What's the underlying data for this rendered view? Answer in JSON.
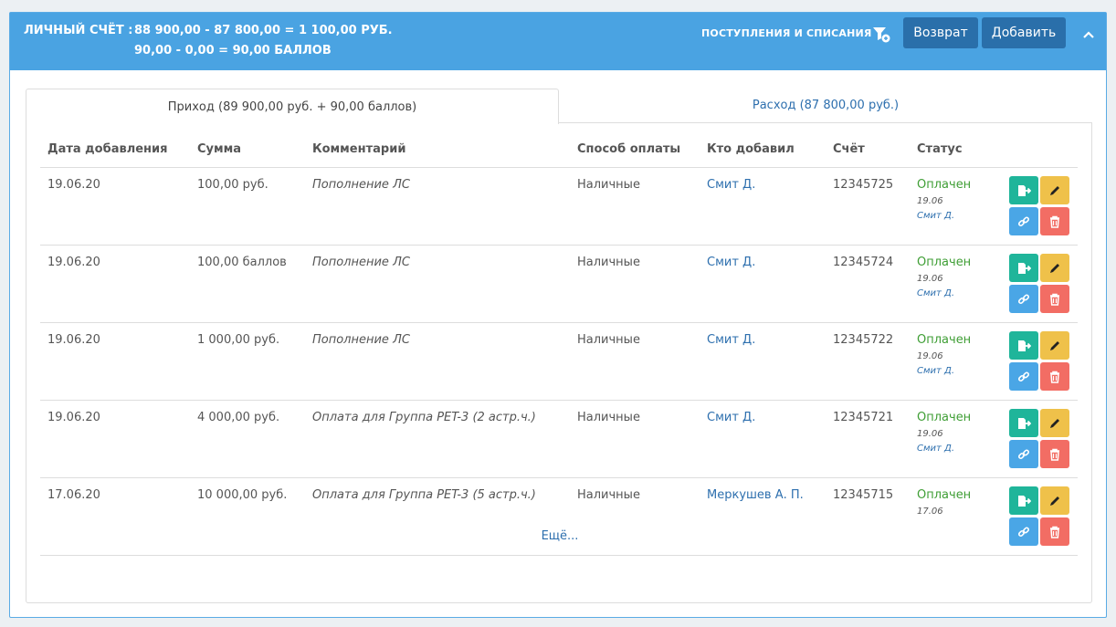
{
  "header": {
    "account_label": "ЛИЧНЫЙ СЧЁТ :",
    "line1": "88 900,00 - 87 800,00 = 1 100,00 РУБ.",
    "line2": "90,00 - 0,00 = 90,00 БАЛЛОВ",
    "link": "ПОСТУПЛЕНИЯ И СПИСАНИЯ",
    "return_label": "Возврат",
    "add_label": "Добавить"
  },
  "tabs": {
    "income": "Приход (89 900,00 руб. + 90,00 баллов)",
    "expense": "Расход (87 800,00 руб.)"
  },
  "columns": {
    "date": "Дата добавления",
    "sum": "Сумма",
    "comment": "Комментарий",
    "method": "Способ оплаты",
    "who": "Кто добавил",
    "account": "Счёт",
    "status": "Статус"
  },
  "rows": [
    {
      "date": "19.06.20",
      "sum": "100,00 руб.",
      "comment": "Пополнение ЛС",
      "method": "Наличные",
      "who": "Смит Д.",
      "account": "12345725",
      "status": "Оплачен",
      "status_date": "19.06",
      "status_who": "Смит Д."
    },
    {
      "date": "19.06.20",
      "sum": "100,00 баллов",
      "comment": "Пополнение ЛС",
      "method": "Наличные",
      "who": "Смит Д.",
      "account": "12345724",
      "status": "Оплачен",
      "status_date": "19.06",
      "status_who": "Смит Д."
    },
    {
      "date": "19.06.20",
      "sum": "1 000,00 руб.",
      "comment": "Пополнение ЛС",
      "method": "Наличные",
      "who": "Смит Д.",
      "account": "12345722",
      "status": "Оплачен",
      "status_date": "19.06",
      "status_who": "Смит Д."
    },
    {
      "date": "19.06.20",
      "sum": "4 000,00 руб.",
      "comment": "Оплата для Группа PET-3 (2 астр.ч.)",
      "method": "Наличные",
      "who": "Смит Д.",
      "account": "12345721",
      "status": "Оплачен",
      "status_date": "19.06",
      "status_who": "Смит Д."
    },
    {
      "date": "17.06.20",
      "sum": "10 000,00 руб.",
      "comment": "Оплата для Группа PET-3 (5 астр.ч.)",
      "method": "Наличные",
      "who": "Меркушев А. П.",
      "account": "12345715",
      "status": "Оплачен",
      "status_date": "17.06",
      "status_who": ""
    }
  ],
  "more_label": "Ещё...",
  "colors": {
    "header_bg": "#4aa3e2",
    "header_button": "#2a6faa",
    "status_paid": "#3f9e35",
    "link": "#2d6fae",
    "btn_export": "#1fb59a",
    "btn_edit": "#efc14a",
    "btn_link": "#4aa6e6",
    "btn_delete": "#f26d64"
  },
  "icons": {
    "filter": "filter-icon",
    "collapse": "chevron-up-icon",
    "export": "file-export-icon",
    "edit": "pencil-icon",
    "link": "link-icon",
    "delete": "trash-icon"
  }
}
